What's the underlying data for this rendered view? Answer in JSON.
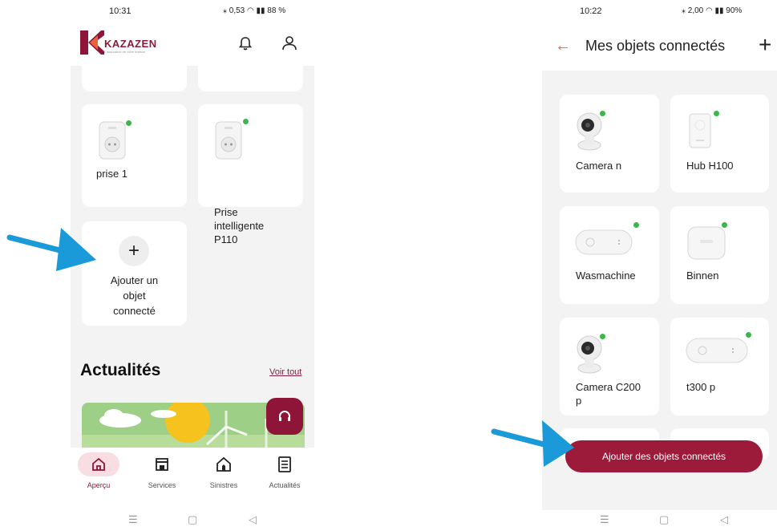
{
  "left_phone": {
    "status": {
      "time": "10:31",
      "icons": "⁎ 0,53 ◠ ▮▮ 88 %"
    },
    "brand": {
      "name": "KAZAZEN",
      "tagline": "L'assurance de votre maison"
    },
    "cards": [
      {
        "label": "prise 1"
      },
      {
        "label": "Prise intelligente P110"
      }
    ],
    "add_card": {
      "plus": "+",
      "label": "Ajouter un objet connecté"
    },
    "news": {
      "title": "Actualités",
      "see_all": "Voir tout"
    },
    "nav": [
      {
        "label": "Aperçu",
        "icon": "home-icon"
      },
      {
        "label": "Services",
        "icon": "store-icon"
      },
      {
        "label": "Sinistres",
        "icon": "house-damage-icon"
      },
      {
        "label": "Actualités",
        "icon": "news-icon"
      }
    ]
  },
  "right_phone": {
    "status": {
      "time": "10:22",
      "icons": "⁎ 2,00 ◠ ▮▮ 90%"
    },
    "header": {
      "back": "←",
      "title": "Mes objets connectés",
      "plus": "+"
    },
    "devices": [
      {
        "label": "Camera n"
      },
      {
        "label": "Hub H100"
      },
      {
        "label": "Wasmachine"
      },
      {
        "label": "Binnen"
      },
      {
        "label": "Camera C200 p"
      },
      {
        "label": "t300 p"
      }
    ],
    "add_button": "Ajouter des objets connectés"
  },
  "system_nav": {
    "menu": "☰",
    "home": "▢",
    "back": "◁"
  },
  "colors": {
    "brand": "#8e1538",
    "online": "#3cb54a",
    "arrow": "#1a9ad8",
    "background": "#f3f3f3"
  }
}
